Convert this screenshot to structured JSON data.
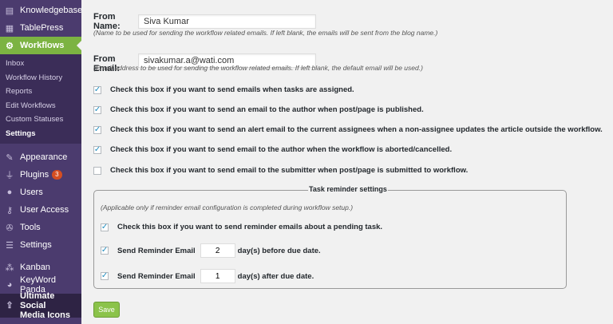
{
  "sidebar": {
    "items_top": [
      {
        "label": "Knowledgebase",
        "icon": "book-icon"
      },
      {
        "label": "TablePress",
        "icon": "table-icon"
      }
    ],
    "active": {
      "label": "Workflows",
      "icon": "gear-icon"
    },
    "submenu": [
      "Inbox",
      "Workflow History",
      "Reports",
      "Edit Workflows",
      "Custom Statuses",
      "Settings"
    ],
    "current_submenu": "Settings",
    "items_bottom": [
      {
        "label": "Appearance",
        "icon": "brush-icon"
      },
      {
        "label": "Plugins",
        "icon": "plug-icon",
        "badge": "3"
      },
      {
        "label": "Users",
        "icon": "user-icon"
      },
      {
        "label": "User Access",
        "icon": "key-icon"
      },
      {
        "label": "Tools",
        "icon": "wrench-icon"
      },
      {
        "label": "Settings",
        "icon": "sliders-icon"
      }
    ],
    "items_extra": [
      {
        "label": "Kanban",
        "icon": "kanban-icon"
      },
      {
        "label": "KeyWord Panda",
        "icon": "panda-icon"
      }
    ],
    "social": {
      "line1": "Ultimate Social",
      "line2": "Media Icons"
    }
  },
  "form": {
    "from_name": {
      "label": "From Name:",
      "value": "Siva Kumar",
      "help": "(Name to be used for sending the workflow related emails. If left blank, the emails will be sent from the blog name.)"
    },
    "from_email": {
      "label": "From Email:",
      "value": "sivakumar.a@wati.com",
      "help": "(Email address to be used for sending the workflow related emails. If left blank, the default email will be used.)"
    },
    "checkboxes": [
      {
        "label": "Check this box if you want to send emails when tasks are assigned.",
        "checked": true
      },
      {
        "label": "Check this box if you want to send an email to the author when post/page is published.",
        "checked": true
      },
      {
        "label": "Check this box if you want to send an alert email to the current assignees when a non-assignee updates the article outside the workflow.",
        "checked": true
      },
      {
        "label": "Check this box if you want to send email to the author when the workflow is aborted/cancelled.",
        "checked": true
      },
      {
        "label": "Check this box if you want to send email to the submitter when post/page is submitted to workflow.",
        "checked": false
      }
    ],
    "reminder": {
      "legend": "Task reminder settings",
      "note": "(Applicable only if reminder email configuration is completed during workflow setup.)",
      "pending": {
        "label": "Check this box if you want to send reminder emails about a pending task.",
        "checked": true
      },
      "before": {
        "label": "Send Reminder Email",
        "value": "2",
        "suffix": "day(s) before due date.",
        "checked": true
      },
      "after": {
        "label": "Send Reminder Email",
        "value": "1",
        "suffix": "day(s) after due date.",
        "checked": true
      }
    },
    "save_label": "Save"
  },
  "colors": {
    "sidebar": "#4b3b6e",
    "active": "#7cb342",
    "save": "#8bc34a"
  }
}
